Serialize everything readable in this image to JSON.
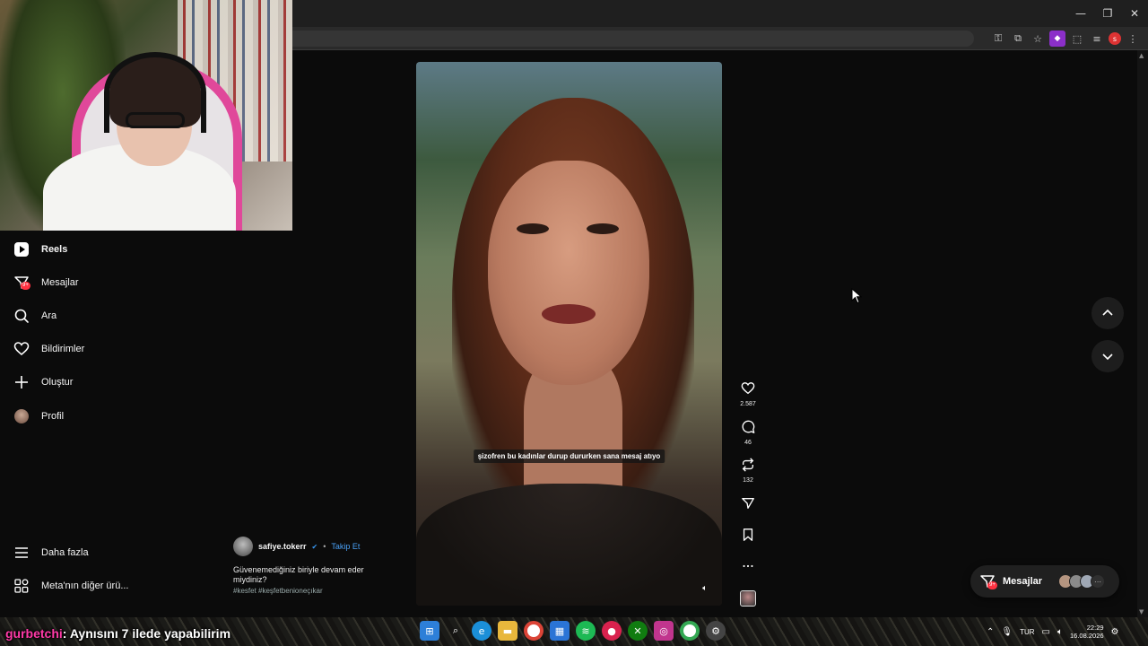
{
  "window": {
    "minimize": "—",
    "maximize": "❐",
    "close": "✕"
  },
  "sidebar": {
    "items": [
      {
        "label": "Reels",
        "icon": "reels-icon"
      },
      {
        "label": "Mesajlar",
        "icon": "messenger-icon",
        "badge": "9+"
      },
      {
        "label": "Ara",
        "icon": "search-icon"
      },
      {
        "label": "Bildirimler",
        "icon": "heart-icon"
      },
      {
        "label": "Oluştur",
        "icon": "plus-icon"
      },
      {
        "label": "Profil",
        "icon": "avatar"
      }
    ],
    "bottom": [
      {
        "label": "Daha fazla",
        "icon": "menu-icon"
      },
      {
        "label": "Meta'nın diğer ürü...",
        "icon": "meta-apps-icon"
      }
    ]
  },
  "post": {
    "username": "safiye.tokerr",
    "separator": "•",
    "follow": "Takip Et",
    "caption_line1": "Güvenemediğiniz biriyle devam eder",
    "caption_line2": "miydiniz?",
    "hashtags": "#kesfet #keşfetbenioneçıkar",
    "subtitle": "şizofren bu kadınlar durup dururken sana mesaj atıyo"
  },
  "actions": {
    "likes": "2.587",
    "comments": "46",
    "reposts": "132"
  },
  "messages_pill": {
    "label": "Mesajlar",
    "badge": "9+"
  },
  "stream_chat": {
    "user": "gurbetchi",
    "message": " : Aynısını 7 ilede yapabilirim"
  },
  "taskbar": {
    "language": "TUR",
    "time": "22:29",
    "date": "16.08.2026"
  },
  "colors": {
    "accent_red": "#ff3040",
    "link_blue": "#4aa0f5",
    "chat_user": "#ff3aa8"
  }
}
